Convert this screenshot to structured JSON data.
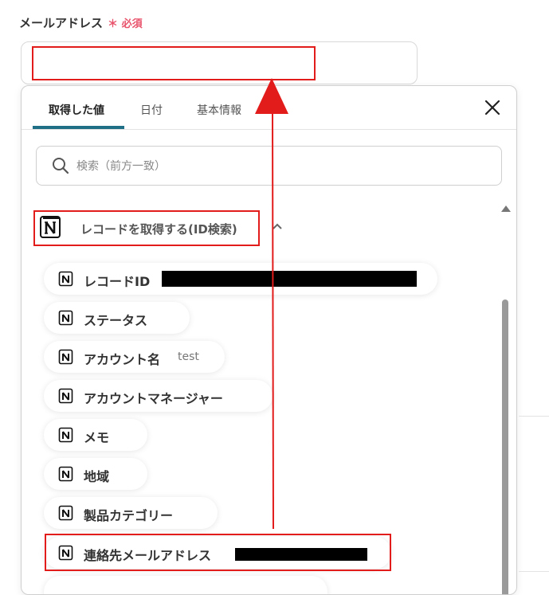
{
  "form": {
    "label": "メールアドレス",
    "required_mark": "＊",
    "required_text": "必須",
    "email_value": ""
  },
  "tabs": [
    {
      "label": "取得した値",
      "active": true
    },
    {
      "label": "日付",
      "active": false
    },
    {
      "label": "基本情報",
      "active": false
    }
  ],
  "search": {
    "placeholder": "検索（前方一致）"
  },
  "section": {
    "title": "レコードを取得する(ID検索)"
  },
  "items": [
    {
      "label": "レコードID",
      "value": "",
      "redacted": true
    },
    {
      "label": "ステータス",
      "value": ""
    },
    {
      "label": "アカウント名",
      "value": "test"
    },
    {
      "label": "アカウントマネージャー",
      "value": ""
    },
    {
      "label": "メモ",
      "value": ""
    },
    {
      "label": "地域",
      "value": ""
    },
    {
      "label": "製品カテゴリー",
      "value": ""
    },
    {
      "label": "連絡先メールアドレス",
      "value": "",
      "redacted": true
    }
  ],
  "icons": {
    "close": "close-icon",
    "search": "search-icon",
    "notion": "notion-icon",
    "chevron": "chevron-up-icon"
  },
  "colors": {
    "accent": "#1f6f86",
    "required": "#e8536b",
    "annotation": "#e21b1b"
  }
}
